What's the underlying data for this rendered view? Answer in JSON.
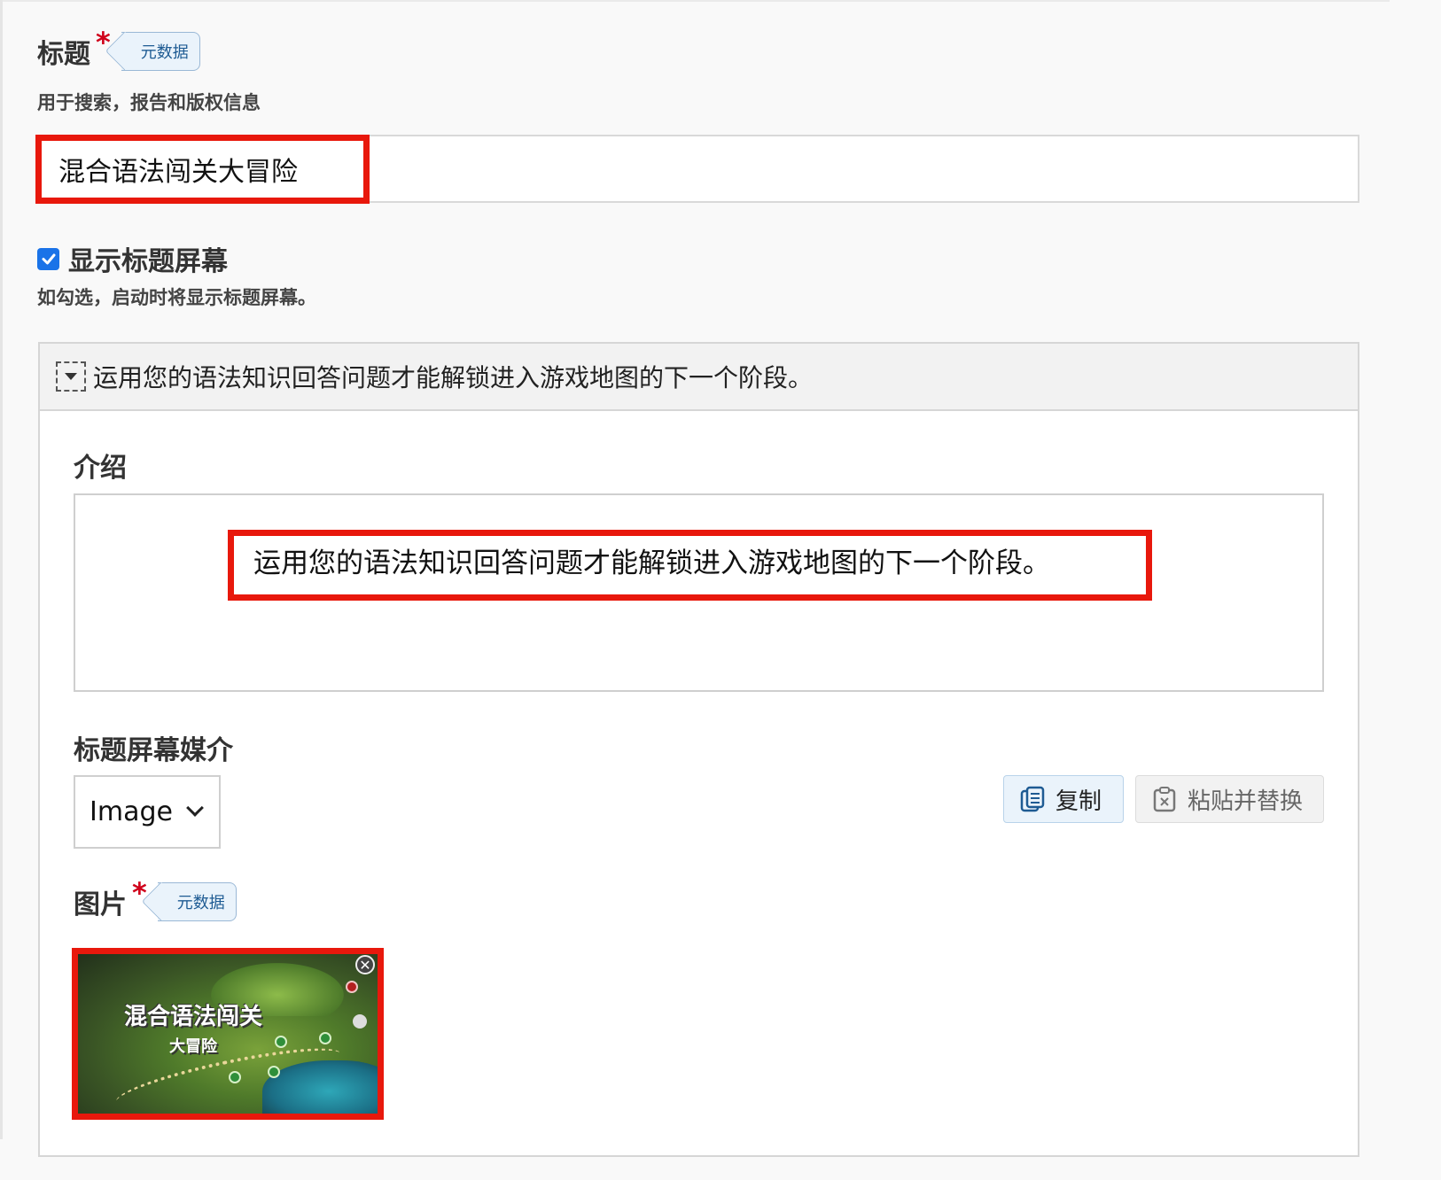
{
  "title_field": {
    "label": "标题",
    "required_mark": "*",
    "meta_tag": "元数据",
    "description": "用于搜索，报告和版权信息",
    "value": "混合语法闯关大冒险"
  },
  "show_title_screen": {
    "label": "显示标题屏幕",
    "checked": true,
    "description": "如勾选，启动时将显示标题屏幕。"
  },
  "panel": {
    "header_text": "运用您的语法知识回答问题才能解锁进入游戏地图的下一个阶段。",
    "intro": {
      "label": "介绍",
      "text": "运用您的语法知识回答问题才能解锁进入游戏地图的下一个阶段。"
    },
    "media": {
      "label": "标题屏幕媒介",
      "selected": "Image",
      "copy_button": "复制",
      "paste_button": "粘贴并替换"
    },
    "image": {
      "label": "图片",
      "required_mark": "*",
      "meta_tag": "元数据",
      "thumb_title": "混合语法闯关",
      "thumb_subtitle": "大冒险"
    }
  },
  "colors": {
    "highlight": "#e8180c",
    "accent": "#1a73e8",
    "required": "#d0021b",
    "meta_tag_bg": "#eaf3fb"
  }
}
